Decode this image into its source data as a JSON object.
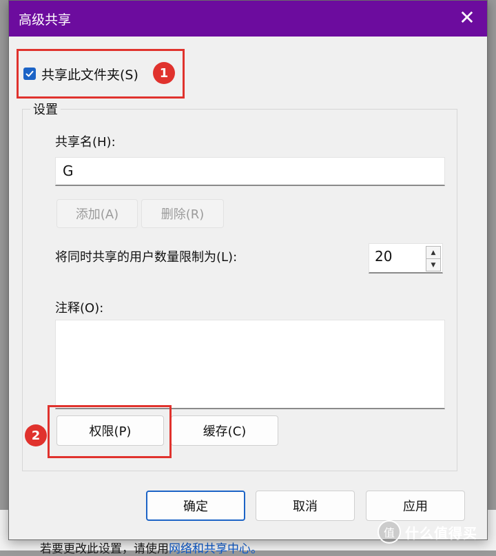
{
  "dialog": {
    "title": "高级共享",
    "close_glyph": "✕"
  },
  "share_checkbox": {
    "label": "共享此文件夹(S)",
    "checked": true,
    "check_glyph": "✓"
  },
  "annotations": [
    {
      "number": "1"
    },
    {
      "number": "2"
    }
  ],
  "settings": {
    "group_title": "设置",
    "share_name_label": "共享名(H):",
    "share_name_value": "G",
    "add_label": "添加(A)",
    "remove_label": "删除(R)",
    "limit_label": "将同时共享的用户数量限制为(L):",
    "limit_value": "20",
    "spin_up_glyph": "▲",
    "spin_down_glyph": "▼",
    "comment_label": "注释(O):",
    "comment_value": "",
    "permissions_label": "权限(P)",
    "caching_label": "缓存(C)"
  },
  "footer": {
    "ok_label": "确定",
    "cancel_label": "取消",
    "apply_label": "应用"
  },
  "background": {
    "bottom_text": "若要更改此设置，请使用",
    "bottom_link": "网络和共享中心。"
  },
  "watermark": {
    "seal_text": "值",
    "text": "什么值得买"
  },
  "colors": {
    "titlebar": "#6c0c9e",
    "checkbox": "#1b63c6",
    "annotation_red": "#e0322d"
  }
}
